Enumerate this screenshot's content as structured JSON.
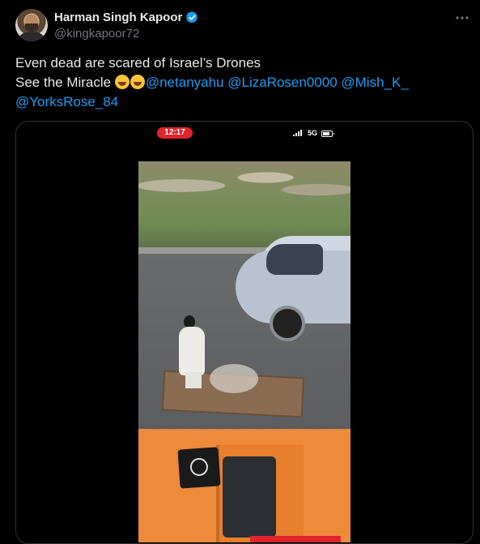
{
  "author": {
    "name": "Harman Singh Kapoor",
    "handle": "@kingkapoor72",
    "verified": true
  },
  "more_icon": "more-horizontal-icon",
  "tweet": {
    "line1": "Even dead are scared of Israel’s Drones",
    "line2_prefix": "See the Miracle ",
    "emojis": [
      "rolling-on-floor-laughing",
      "rolling-on-floor-laughing"
    ],
    "mentions": [
      "@netanyahu",
      "@LizaRosen0000",
      "@Mish_K_",
      "@YorksRose_84"
    ]
  },
  "media": {
    "phone_time": "12:17",
    "network": "5G"
  },
  "colors": {
    "background": "#000000",
    "text": "#e7e9ea",
    "secondary": "#71767b",
    "accent": "#1d9bf0",
    "recording_red": "#e0242b"
  }
}
